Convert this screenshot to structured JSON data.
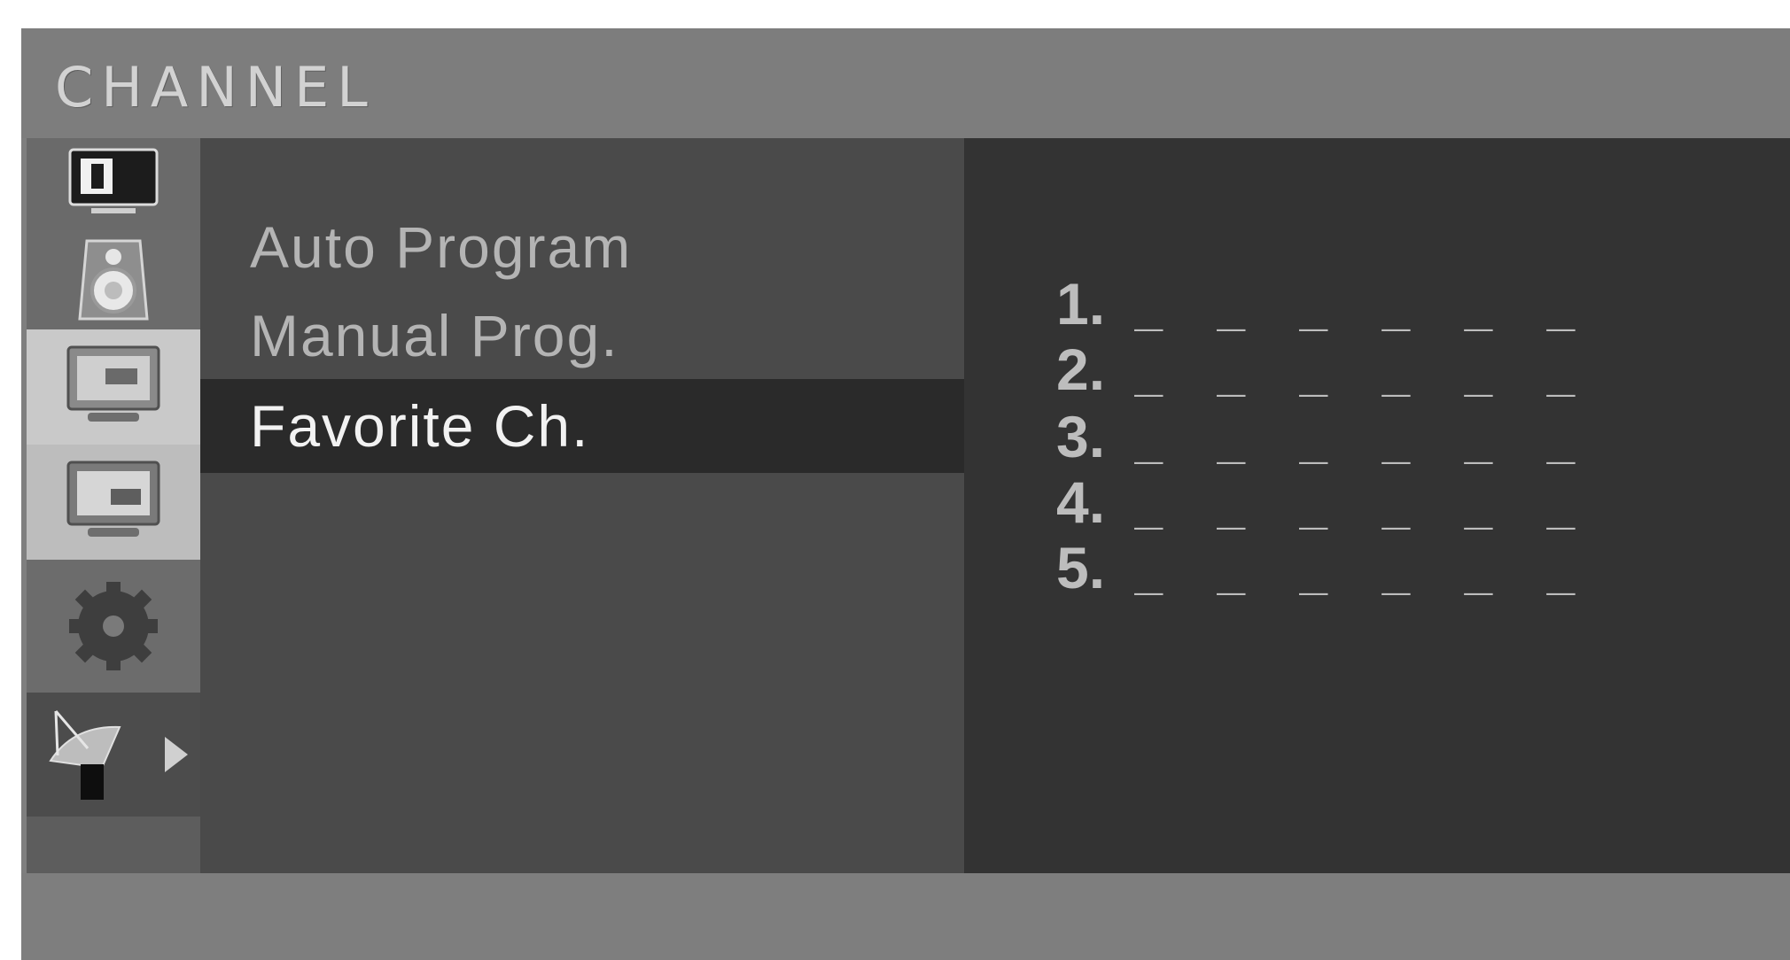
{
  "header": {
    "title": "CHANNEL"
  },
  "sidebar": {
    "items": [
      {
        "name": "picture",
        "icon": "picture-icon",
        "selected": false
      },
      {
        "name": "sound",
        "icon": "speaker-icon",
        "selected": false
      },
      {
        "name": "channel",
        "icon": "tv-channel-icon",
        "selected": true
      },
      {
        "name": "pip",
        "icon": "tv-pip-icon",
        "selected": true
      },
      {
        "name": "setup",
        "icon": "gear-icon",
        "selected": false
      },
      {
        "name": "satellite",
        "icon": "satellite-dish-icon",
        "selected": false
      }
    ]
  },
  "menu": {
    "items": [
      {
        "label": "Auto Program",
        "selected": false
      },
      {
        "label": "Manual Prog.",
        "selected": false
      },
      {
        "label": "Favorite Ch.",
        "selected": true
      }
    ]
  },
  "favorites": {
    "slots": [
      {
        "number": "1.",
        "value": "_ _ _ _ _ _"
      },
      {
        "number": "2.",
        "value": "_ _ _ _ _ _"
      },
      {
        "number": "3.",
        "value": "_ _ _ _ _ _"
      },
      {
        "number": "4.",
        "value": "_ _ _ _ _ _"
      },
      {
        "number": "5.",
        "value": "_ _ _ _ _ _"
      }
    ]
  }
}
